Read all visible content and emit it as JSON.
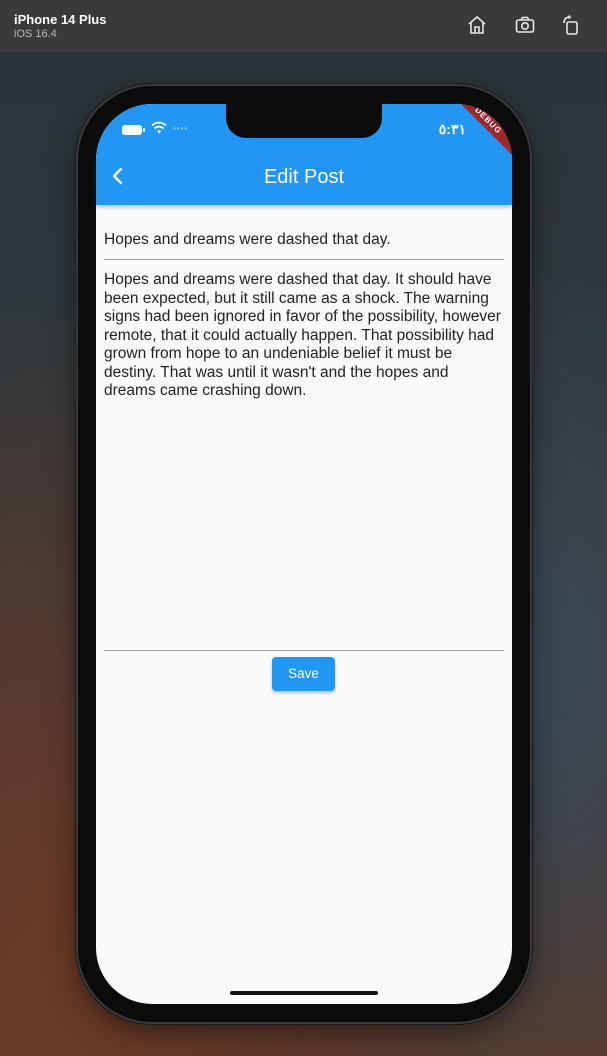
{
  "simulator": {
    "device": "iPhone 14 Plus",
    "os": "iOS 16.4",
    "icons": [
      "home-icon",
      "screenshot-icon",
      "rotate-icon"
    ]
  },
  "status_bar": {
    "time": "٥:٣١",
    "debug_banner": "DEBUG"
  },
  "app_bar": {
    "title": "Edit Post",
    "back_icon": "chevron-left-icon",
    "color": "#2196f3"
  },
  "form": {
    "title_value": "Hopes and dreams were dashed that day.",
    "body_value": "Hopes and dreams were dashed that day. It should have been expected, but it still came as a shock. The warning signs had been ignored in favor of the possibility, however remote, that it could actually happen. That possibility had grown from hope to an undeniable belief it must be destiny. That was until it wasn't and the hopes and dreams came crashing down.",
    "save_label": "Save"
  }
}
